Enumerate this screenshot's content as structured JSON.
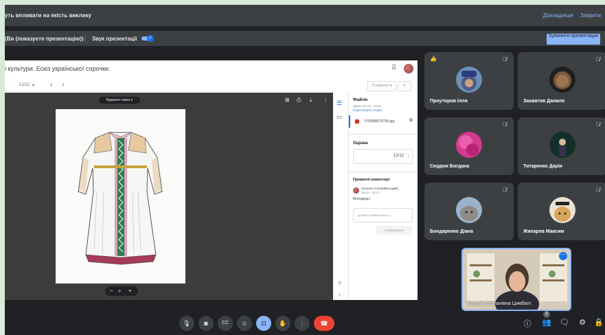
{
  "notice": {
    "text": "уть впливати на якість виклику",
    "learn_more": "Докладніше",
    "close": "Закрити"
  },
  "presenting": {
    "status": "(Ви (показуєте презентацію))",
    "audio_label": "Звук презентації",
    "audio_enabled": true,
    "stop_button": "Зупинити презентацію",
    "toggle_check": "✓"
  },
  "presentation": {
    "title": "і культури. Ескіз української сорочки.",
    "page": "12/12",
    "dropdown": "▾",
    "prev": "‹",
    "next": "›",
    "return_button": "Повернути",
    "return_dropdown": "▾",
    "grid_icon": "⠿",
    "open_with": "Відкрити через ▾",
    "viewer_icons": [
      "⊞",
      "⎙",
      "⤓",
      "⋮"
    ],
    "zoom": {
      "minus": "−",
      "search": "⌕",
      "plus": "+"
    },
    "side": {
      "strip_icons": [
        "☰",
        "▭"
      ],
      "files_heading": "Файли",
      "files_meta": "Здано 18 січ., 16:55",
      "files_link": "Переглянути історію",
      "file_name": "1705586576706.jpg",
      "file_open": "⧉",
      "grade_heading": "Оцінка",
      "grade_value": "12/12",
      "grade_more": "⋮",
      "comments_heading": "Приватні коментарі",
      "comment_author": "Наталія Степанівна Цимб...",
      "comment_time": "18 січ., 18:17",
      "comment_text": "Молодець!",
      "comment_placeholder": "Додайте приватний ко...",
      "send_button": "Опублікувати",
      "help_icon": "?",
      "collapse_icon": "›"
    }
  },
  "participants": [
    {
      "name": "Проуторов Ілля",
      "mic": "🎙̸",
      "hand": "👍"
    },
    {
      "name": "Захватов Данило",
      "mic": "🎙̸"
    },
    {
      "name": "Сердюк Богдана",
      "mic": "🎙̸"
    },
    {
      "name": "Титаренко Дарія",
      "mic": "🎙̸"
    },
    {
      "name": "Бондаренко Діана",
      "mic": "🎙̸"
    },
    {
      "name": "Жихарев Максим",
      "mic": "🎙̸"
    }
  ],
  "self_view": {
    "name": "Наталія Степанівна Цимбалі",
    "more": "⋯"
  },
  "controls": {
    "mic": "🎙",
    "camera": "◙",
    "captions": "CC",
    "emoji": "☺",
    "present": "⊡",
    "hand": "✋",
    "more": "⋮",
    "leave": "☎"
  },
  "right_controls": {
    "info": "ⓘ",
    "people": "👥",
    "people_count": "8",
    "chat": "🗨",
    "activities": "⚙",
    "lock": "🔒"
  },
  "colors": {
    "background": "#202124",
    "tile": "#3c4043",
    "accent": "#8ab4f8",
    "leave": "#ea4335"
  }
}
